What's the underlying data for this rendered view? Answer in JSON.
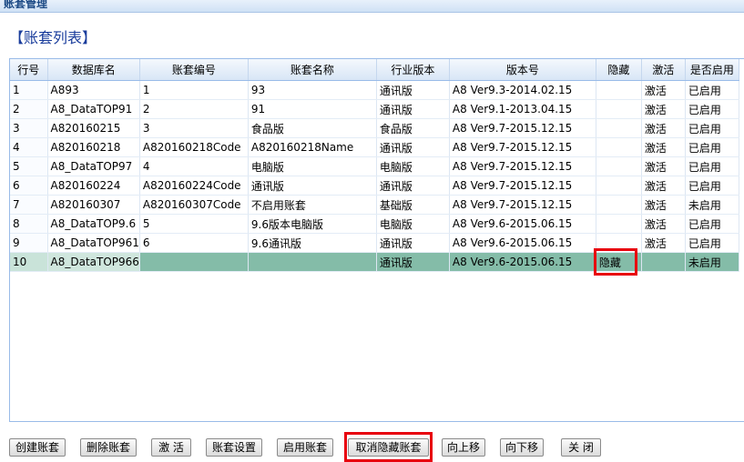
{
  "window": {
    "title": "账套管理"
  },
  "section_title": "【账套列表】",
  "table": {
    "columns": [
      "行号",
      "数据库名",
      "账套编号",
      "账套名称",
      "行业版本",
      "版本号",
      "隐藏",
      "激活",
      "是否启用"
    ],
    "rows": [
      [
        "1",
        "A893",
        "1",
        "93",
        "通讯版",
        "A8 Ver9.3-2014.02.15",
        "",
        "激活",
        "已启用"
      ],
      [
        "2",
        "A8_DataTOP91",
        "2",
        "91",
        "通讯版",
        "A8 Ver9.1-2013.04.15",
        "",
        "激活",
        "已启用"
      ],
      [
        "3",
        "A820160215",
        "3",
        "食品版",
        "食品版",
        "A8 Ver9.7-2015.12.15",
        "",
        "激活",
        "已启用"
      ],
      [
        "4",
        "A820160218",
        "A820160218Code",
        "A820160218Name",
        "通讯版",
        "A8 Ver9.7-2015.12.15",
        "",
        "激活",
        "已启用"
      ],
      [
        "5",
        "A8_DataTOP97",
        "4",
        "电脑版",
        "电脑版",
        "A8 Ver9.7-2015.12.15",
        "",
        "激活",
        "已启用"
      ],
      [
        "6",
        "A820160224",
        "A820160224Code",
        "通讯版",
        "通讯版",
        "A8 Ver9.7-2015.12.15",
        "",
        "激活",
        "已启用"
      ],
      [
        "7",
        "A820160307",
        "A820160307Code",
        "不启用账套",
        "基础版",
        "A8 Ver9.7-2015.12.15",
        "",
        "激活",
        "未启用"
      ],
      [
        "8",
        "A8_DataTOP9.6",
        "5",
        "9.6版本电脑版",
        "电脑版",
        "A8 Ver9.6-2015.06.15",
        "",
        "激活",
        "已启用"
      ],
      [
        "9",
        "A8_DataTOP961",
        "6",
        "9.6通讯版",
        "通讯版",
        "A8 Ver9.6-2015.06.15",
        "",
        "激活",
        "已启用"
      ],
      [
        "10",
        "A8_DataTOP966",
        "",
        "",
        "通讯版",
        "A8 Ver9.6-2015.06.15",
        "隐藏",
        "",
        "未启用"
      ]
    ],
    "selected_row": 9
  },
  "buttons": {
    "create": "创建账套",
    "delete": "删除账套",
    "activate": "激 活",
    "settings": "账套设置",
    "enable": "启用账套",
    "unhide": "取消隐藏账套",
    "move_up": "向上移",
    "move_down": "向下移",
    "close": "关 闭"
  },
  "colors": {
    "selected_row": "#84bca8",
    "highlight_box": "#e8000e",
    "title_text": "#1a3d9c"
  }
}
